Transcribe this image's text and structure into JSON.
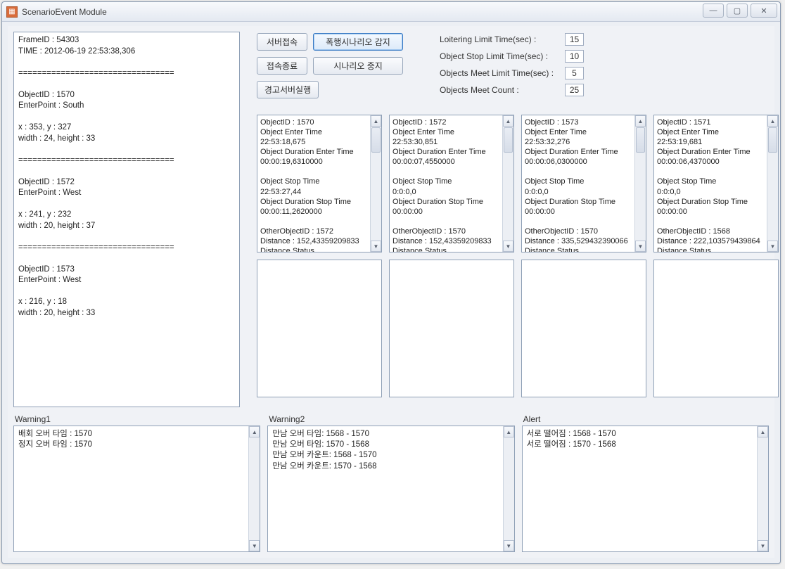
{
  "window": {
    "title": "ScenarioEvent Module",
    "minimize": "—",
    "maximize": "▢",
    "close": "✕"
  },
  "leftlog": "FrameID : 54303\nTIME : 2012-06-19 22:53:38,306\n\n=================================\n\nObjectID : 1570\nEnterPoint : South\n\nx : 353, y : 327\nwidth : 24, height : 33\n\n=================================\n\nObjectID : 1572\nEnterPoint : West\n\nx : 241, y : 232\nwidth : 20, height : 37\n\n=================================\n\nObjectID : 1573\nEnterPoint : West\n\nx : 216, y : 18\nwidth : 20, height : 33",
  "buttons": {
    "server_connect": "서버접속",
    "connect_end": "접속종료",
    "warning_server": "경고서버실행",
    "detect_scenario": "폭행시나리오 감지",
    "stop_scenario": "시나리오 중지"
  },
  "limits": {
    "loitering_label": "Loitering Limit Time(sec) :",
    "loitering_val": "15",
    "stop_label": "Object Stop Limit Time(sec) :",
    "stop_val": "10",
    "meet_time_label": "Objects Meet Limit Time(sec) :",
    "meet_time_val": "5",
    "meet_count_label": "Objects Meet Count :",
    "meet_count_val": "25"
  },
  "objects": [
    "ObjectID : 1570\nObject Enter Time\n22:53:18,675\nObject Duration Enter Time\n00:00:19,6310000\n\nObject Stop Time\n22:53:27,44\nObject Duration Stop Time\n00:00:11,2620000\n\nOtherObjectID : 1572\nDistance : 152,43359209833\nDistance Status\n가까워짐",
    "ObjectID : 1572\nObject Enter Time\n22:53:30,851\nObject Duration Enter Time\n00:00:07,4550000\n\nObject Stop Time\n0:0:0,0\nObject Duration Stop Time\n00:00:00\n\nOtherObjectID : 1570\nDistance : 152,43359209833\nDistance Status\n가까워짐",
    "ObjectID : 1573\nObject Enter Time\n22:53:32,276\nObject Duration Enter Time\n00:00:06,0300000\n\nObject Stop Time\n0:0:0,0\nObject Duration Stop Time\n00:00:00\n\nOtherObjectID : 1570\nDistance : 335,529432390066\nDistance Status\n일정거리 유지",
    "ObjectID : 1571\nObject Enter Time\n22:53:19,681\nObject Duration Enter Time\n00:00:06,4370000\n\nObject Stop Time\n0:0:0,0\nObject Duration Stop Time\n00:00:00\n\nOtherObjectID : 1568\nDistance : 222,103579439864\nDistance Status\n일정거리 유지",
    "",
    "",
    "",
    ""
  ],
  "warning1": {
    "label": "Warning1",
    "text": "배회 오버 타임 : 1570\n정지 오버 타임 : 1570"
  },
  "warning2": {
    "label": "Warning2",
    "text": "만남 오버 타임: 1568 - 1570\n만남 오버 타임: 1570 - 1568\n만남 오버 카운트: 1568 - 1570\n만남 오버 카운트: 1570 - 1568"
  },
  "alert": {
    "label": "Alert",
    "text": "서로 떨어짐 : 1568 - 1570\n서로 떨어짐 : 1570 - 1568"
  }
}
